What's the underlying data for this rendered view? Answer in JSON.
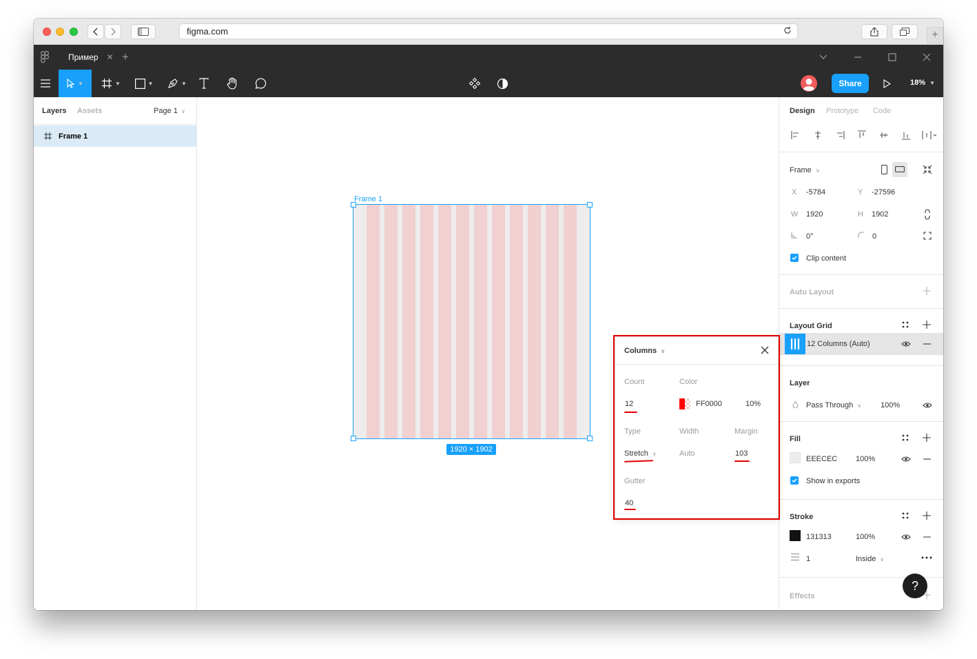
{
  "browser": {
    "url": "figma.com"
  },
  "titlebar": {
    "tab_title": "Пример",
    "tab_close": "✕",
    "new_tab": "+"
  },
  "toolbar": {
    "share_label": "Share",
    "zoom": "18%"
  },
  "left_panel": {
    "tabs": [
      "Layers",
      "Assets"
    ],
    "page_selector": "Page 1",
    "layers": [
      {
        "name": "Frame 1",
        "selected": true
      }
    ]
  },
  "canvas": {
    "frame_label": "Frame 1",
    "size_badge": "1920 × 1902",
    "column_count": 12,
    "fill_color": "#EEECEC",
    "column_color": "#F0D0D0",
    "selection_color": "#18A0FB"
  },
  "right_panel": {
    "tabs": [
      "Design",
      "Prototype",
      "Code"
    ],
    "frame_label": "Frame",
    "x_label": "X",
    "x": "-5784",
    "y_label": "Y",
    "y": "-27596",
    "w_label": "W",
    "w": "1920",
    "h_label": "H",
    "h": "1902",
    "rotation": "0°",
    "radius": "0",
    "clip_content": "Clip content",
    "auto_layout": "Auto Layout",
    "layout_grid": "Layout Grid",
    "grid_item": "12 Columns (Auto)",
    "layer": "Layer",
    "blend_mode": "Pass Through",
    "layer_opacity": "100%",
    "fill": "Fill",
    "fill_hex": "EEECEC",
    "fill_opacity": "100%",
    "show_in_exports": "Show in exports",
    "stroke": "Stroke",
    "stroke_hex": "131313",
    "stroke_opacity": "100%",
    "stroke_weight": "1",
    "stroke_align": "Inside",
    "effects": "Effects"
  },
  "grid_popup": {
    "title": "Columns",
    "count_label": "Count",
    "count": "12",
    "color_label": "Color",
    "color_hex": "FF0000",
    "color_opacity": "10%",
    "type_label": "Type",
    "type": "Stretch",
    "width_label": "Width",
    "width": "Auto",
    "margin_label": "Margin",
    "margin": "103",
    "gutter_label": "Gutter",
    "gutter": "40"
  },
  "help_label": "?",
  "colors": {
    "accent": "#18A0FB",
    "annotation_red": "#E20000",
    "figma_dark": "#2C2C2C"
  }
}
